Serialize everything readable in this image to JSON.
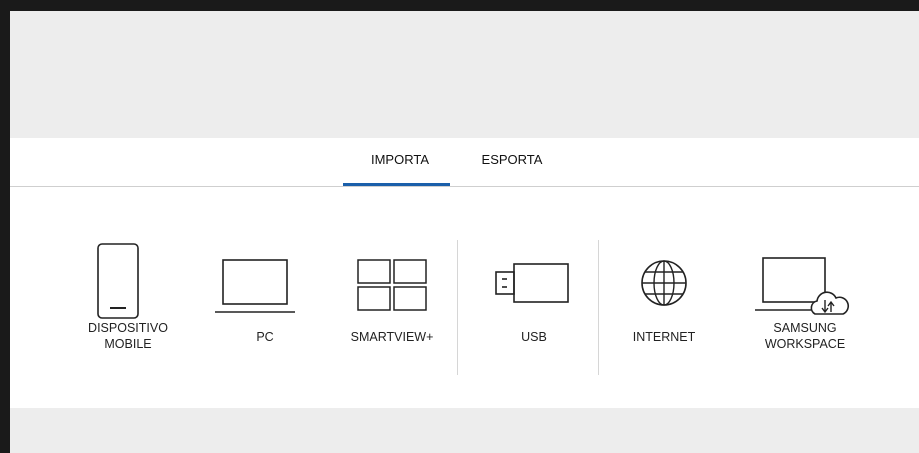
{
  "tabs": [
    {
      "label": "IMPORTA",
      "selected": true
    },
    {
      "label": "ESPORTA",
      "selected": false
    }
  ],
  "sources": [
    {
      "label_line1": "DISPOSITIVO",
      "label_line2": "MOBILE",
      "icon": "mobile-phone-icon"
    },
    {
      "label_line1": "PC",
      "label_line2": "",
      "icon": "laptop-icon"
    },
    {
      "label_line1": "SMARTVIEW+",
      "label_line2": "",
      "icon": "grid-screens-icon"
    },
    {
      "label_line1": "USB",
      "label_line2": "",
      "icon": "usb-drive-icon"
    },
    {
      "label_line1": "INTERNET",
      "label_line2": "",
      "icon": "globe-icon"
    },
    {
      "label_line1": "SAMSUNG",
      "label_line2": "WORKSPACE",
      "icon": "laptop-cloud-icon"
    }
  ],
  "colors": {
    "accent": "#1a5faa",
    "icon_stroke": "#222222",
    "panel_bg": "#ffffff",
    "outer_bg": "#ededed",
    "frame": "#1a1a1a"
  }
}
